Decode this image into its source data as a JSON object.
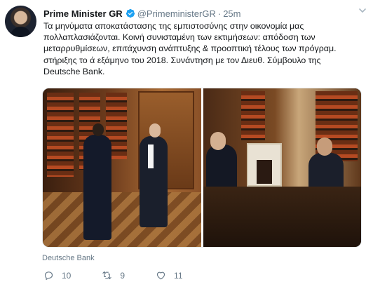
{
  "author": {
    "display_name": "Prime Minister GR",
    "handle": "@PrimeministerGR",
    "separator": "·",
    "time": "25m"
  },
  "tweet": {
    "lines": [
      "Τα μηνύματα αποκατάστασης της εμπιστοσύνης στην οικονομία μας",
      "πολλαπλασιάζονται. Κοινή συνισταμένη των εκτιμήσεων: απόδοση των",
      "μεταρρυθμίσεων, επιτάχυνση ανάπτυξης & προοπτική τέλους των πρόγραμ.",
      "στήριξης το ά εξάμηνο του 2018. Συνάντηση με τον Διευθ. Σύμβουλο της",
      "Deutsche Bank."
    ]
  },
  "media": {
    "caption": "Deutsche Bank"
  },
  "actions": {
    "replies": "10",
    "retweets": "9",
    "likes": "11"
  },
  "colors": {
    "verified": "#1da1f2",
    "muted": "#657786",
    "text": "#14171a"
  },
  "icons": [
    "verified-badge-icon",
    "caret-down-icon",
    "reply-icon",
    "retweet-icon",
    "like-icon"
  ]
}
